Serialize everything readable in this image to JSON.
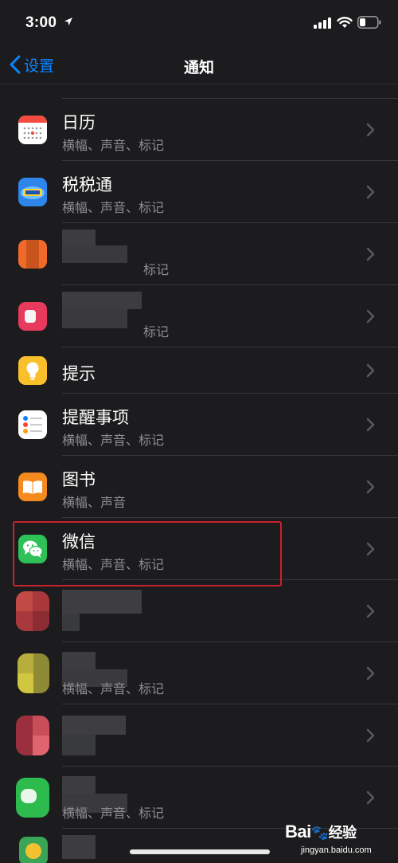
{
  "status_bar": {
    "time": "3:00"
  },
  "nav": {
    "back_label": "设置",
    "title": "通知"
  },
  "apps": [
    {
      "name": "日历",
      "subtitle": "横幅、声音、标记",
      "icon": "calendar-icon"
    },
    {
      "name": "税税通",
      "subtitle": "横幅、声音、标记",
      "icon": "tax-app-icon"
    },
    {
      "name": "",
      "subtitle": "标记",
      "icon": "blurred-app-icon"
    },
    {
      "name": "",
      "subtitle": "标记",
      "icon": "blurred-app-icon"
    },
    {
      "name": "提示",
      "subtitle": "",
      "icon": "tips-lightbulb-icon"
    },
    {
      "name": "提醒事项",
      "subtitle": "横幅、声音、标记",
      "icon": "reminders-icon"
    },
    {
      "name": "图书",
      "subtitle": "横幅、声音",
      "icon": "books-icon"
    },
    {
      "name": "微信",
      "subtitle": "横幅、声音、标记",
      "icon": "wechat-icon"
    },
    {
      "name": "",
      "subtitle": "",
      "icon": "blurred-app-icon"
    },
    {
      "name": "",
      "subtitle": "横幅、声音、标记",
      "icon": "blurred-app-icon"
    },
    {
      "name": "",
      "subtitle": "",
      "icon": "blurred-app-icon"
    },
    {
      "name": "",
      "subtitle": "横幅、声音、标记",
      "icon": "blurred-app-icon"
    }
  ],
  "watermark": {
    "logo_text": "Bai",
    "logo_suffix": "经验",
    "url": "jingyan.baidu.com"
  },
  "colors": {
    "background": "#1c1c1e",
    "accent": "#0a84ff",
    "highlight": "#c8232c",
    "secondary_text": "#8e8e93"
  }
}
